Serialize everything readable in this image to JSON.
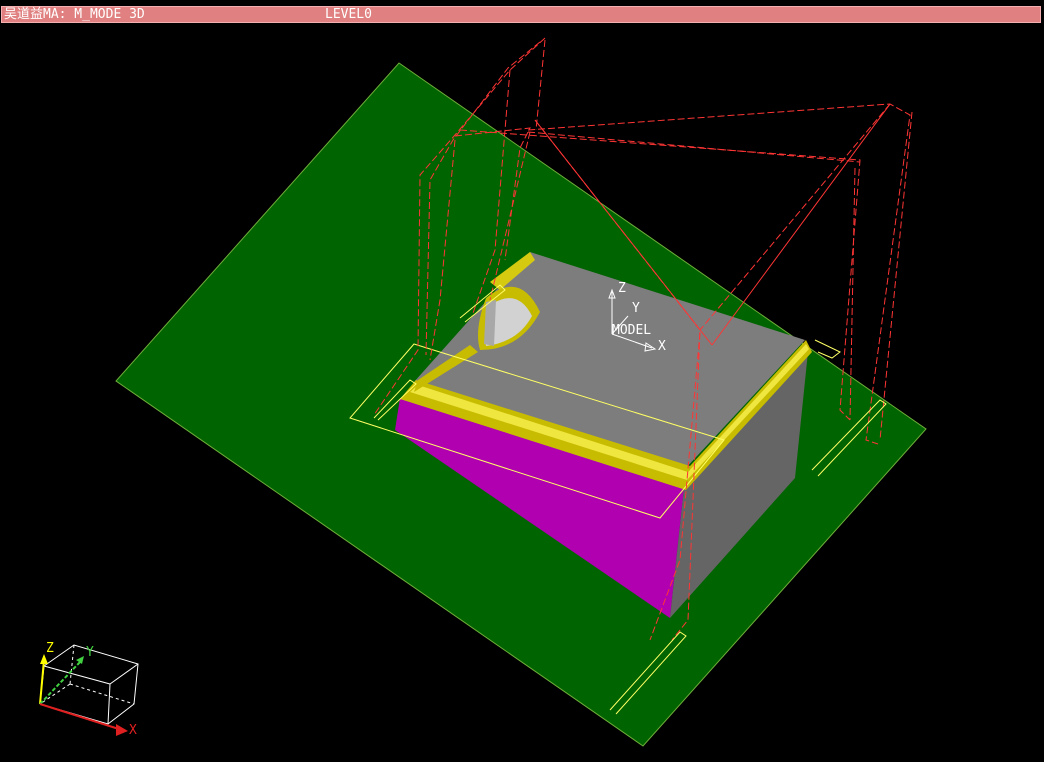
{
  "window": {
    "title": "吴道益MA: M_MODE 3D",
    "level": "LEVEL0"
  },
  "model_triad": {
    "z_label": "Z",
    "y_label": "Y",
    "x_label": "X",
    "model_label": "MODEL"
  },
  "view_triad": {
    "z_label": "Z",
    "y_label": "Y",
    "x_label": "X"
  },
  "colors": {
    "title_bar": "#e08080",
    "background": "#000000",
    "ground_plane": "#006400",
    "block_top": "#808080",
    "block_right_face": "#606060",
    "block_front_face": "#b000b0",
    "fillet": "#d4c800",
    "wireframe": "#ff3030",
    "outline": "#ffff66"
  }
}
